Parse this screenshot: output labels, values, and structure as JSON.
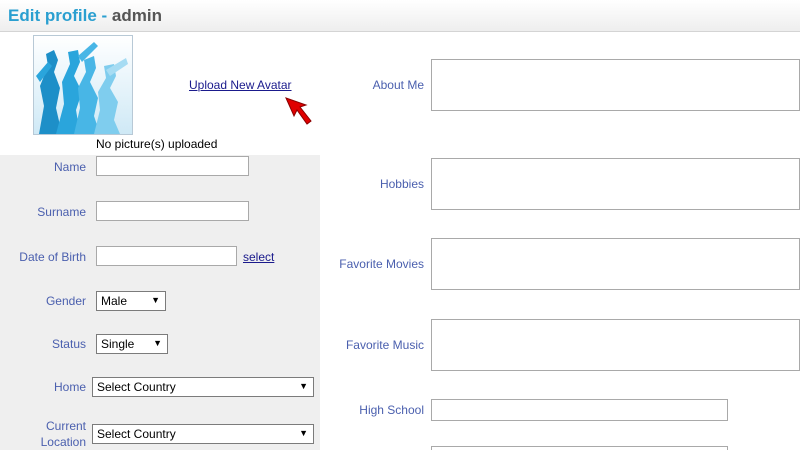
{
  "header": {
    "title": "Edit profile",
    "separator": " - ",
    "user": "admin"
  },
  "avatar": {
    "no_picture_text": "No picture(s) uploaded",
    "upload_link": "Upload New Avatar"
  },
  "left_form": {
    "name_label": "Name",
    "surname_label": "Surname",
    "dob_label": "Date of Birth",
    "dob_select_link": "select",
    "gender_label": "Gender",
    "gender_value": "Male",
    "status_label": "Status",
    "status_value": "Single",
    "home_label": "Home",
    "home_value": "Select Country",
    "current_location_label_1": "Current",
    "current_location_label_2": "Location",
    "current_location_value": "Select Country"
  },
  "right_form": {
    "about_me_label": "About Me",
    "hobbies_label": "Hobbies",
    "favorite_movies_label": "Favorite Movies",
    "favorite_music_label": "Favorite Music",
    "high_school_label": "High School"
  },
  "colors": {
    "accent": "#2a9fd0",
    "label": "#4a5fae",
    "link": "#1a1a8c",
    "arrow": "#e00000"
  }
}
